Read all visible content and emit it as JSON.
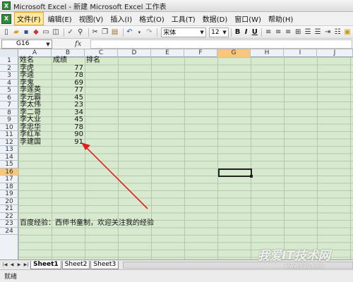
{
  "window": {
    "title": "Microsoft Excel - 新建 Microsoft Excel 工作表",
    "app_icon": "X"
  },
  "menu": {
    "icon": "X",
    "items": [
      "文件(F)",
      "编辑(E)",
      "视图(V)",
      "插入(I)",
      "格式(O)",
      "工具(T)",
      "数据(D)",
      "窗口(W)",
      "帮助(H)"
    ],
    "active_index": 0
  },
  "toolbar": {
    "font_name": "宋体",
    "font_size": "12",
    "bold_label": "B",
    "italic_label": "I",
    "underline_label": "U"
  },
  "formula_bar": {
    "name_box": "G16",
    "fx_label": "fx",
    "formula": ""
  },
  "grid": {
    "columns": [
      "A",
      "B",
      "C",
      "D",
      "E",
      "F",
      "G",
      "H",
      "I",
      "J"
    ],
    "selected_column": "G",
    "rows": [
      "1",
      "2",
      "3",
      "4",
      "5",
      "6",
      "7",
      "8",
      "9",
      "10",
      "11",
      "12",
      "13",
      "14",
      "15",
      "16",
      "17",
      "18",
      "19",
      "20",
      "21",
      "22",
      "23",
      "24"
    ],
    "selected_row": "16",
    "headers": {
      "a1": "姓名",
      "b1": "成绩",
      "c1": "排名"
    },
    "data_rows": [
      {
        "name": "李虎",
        "score": "77"
      },
      {
        "name": "李逵",
        "score": "78"
      },
      {
        "name": "李鬼",
        "score": "69"
      },
      {
        "name": "李莲英",
        "score": "77"
      },
      {
        "name": "李元霸",
        "score": "45"
      },
      {
        "name": "李太伟",
        "score": "23"
      },
      {
        "name": "李二哥",
        "score": "34"
      },
      {
        "name": "李大业",
        "score": "45"
      },
      {
        "name": "李忠华",
        "score": "78"
      },
      {
        "name": "李红军",
        "score": "90"
      },
      {
        "name": "李建国",
        "score": "91"
      }
    ],
    "footer_text": "百度经验：西师书童制，欢迎关注我的经验",
    "background_color": "#d7e9cf"
  },
  "sheets": {
    "tabs": [
      "Sheet1",
      "Sheet2",
      "Sheet3"
    ],
    "active_index": 0
  },
  "status": {
    "text": "就绪"
  },
  "watermark": {
    "text": "我爱IT技术网",
    "url": "www.52ij.com"
  },
  "annotation": {
    "arrow_color": "#e0201e"
  }
}
